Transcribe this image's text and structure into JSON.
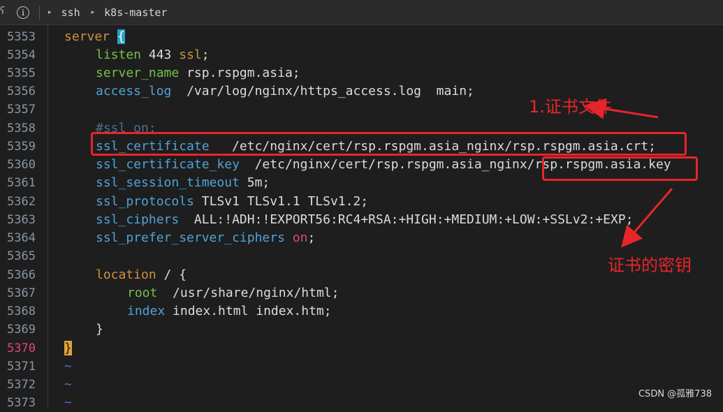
{
  "topbar": {
    "edge_glyph": "ʕ",
    "info_glyph": "i",
    "crumbs": [
      "ssh",
      "k8s-master"
    ],
    "triangle": "▸"
  },
  "lines": [
    {
      "no": "5353"
    },
    {
      "no": "5354"
    },
    {
      "no": "5355"
    },
    {
      "no": "5356"
    },
    {
      "no": "5357"
    },
    {
      "no": "5358"
    },
    {
      "no": "5359"
    },
    {
      "no": "5360"
    },
    {
      "no": "5361"
    },
    {
      "no": "5362"
    },
    {
      "no": "5363"
    },
    {
      "no": "5364"
    },
    {
      "no": "5365"
    },
    {
      "no": "5366"
    },
    {
      "no": "5367"
    },
    {
      "no": "5368"
    },
    {
      "no": "5369"
    },
    {
      "no": "5370",
      "active": true
    },
    {
      "no": "5371"
    },
    {
      "no": "5372"
    },
    {
      "no": "5373"
    }
  ],
  "code": {
    "l5353": {
      "kw": "server",
      "brace": "{"
    },
    "l5354": {
      "dir": "listen",
      "val": "443",
      "ssl": "ssl",
      ";": ";"
    },
    "l5355": {
      "dir": "server_name",
      "val": "rsp.rspgm.asia;"
    },
    "l5356": {
      "dir": "access_log",
      "val": "/var/log/nginx/https_access.log  main;"
    },
    "l5358": {
      "comment": "#ssl on;"
    },
    "l5359": {
      "dir": "ssl_certificate",
      "val": "/etc/nginx/cert/rsp.rspgm.asia_nginx/rsp.rspgm.asia.crt;"
    },
    "l5360": {
      "dir": "ssl_certificate_key",
      "val": "/etc/nginx/cert/rsp.rspgm.asia_nginx/rsp.rspgm.asia.key"
    },
    "l5361": {
      "dir": "ssl_session_timeout",
      "val": "5m;"
    },
    "l5362": {
      "dir": "ssl_protocols",
      "val": "TLSv1 TLSv1.1 TLSv1.2;"
    },
    "l5363": {
      "dir": "ssl_ciphers",
      "val": "ALL:!ADH:!EXPORT56:RC4+RSA:+HIGH:+MEDIUM:+LOW:+SSLv2:+EXP;"
    },
    "l5364": {
      "dir": "ssl_prefer_server_ciphers",
      "on": "on",
      ";": ";"
    },
    "l5366": {
      "kw": "location",
      "val": "/ {"
    },
    "l5367": {
      "dir": "root",
      "val": "/usr/share/nginx/html;"
    },
    "l5368": {
      "dir": "index",
      "val": "index.html index.htm;"
    },
    "l5369": {
      "val": "}"
    },
    "l5370": {
      "brace": "}"
    },
    "tilde": "~"
  },
  "annotations": {
    "cert_file": "1.证书文件",
    "cert_key": "证书的密钥",
    "color": "#e8252b"
  },
  "watermark": "CSDN @孤雅738"
}
